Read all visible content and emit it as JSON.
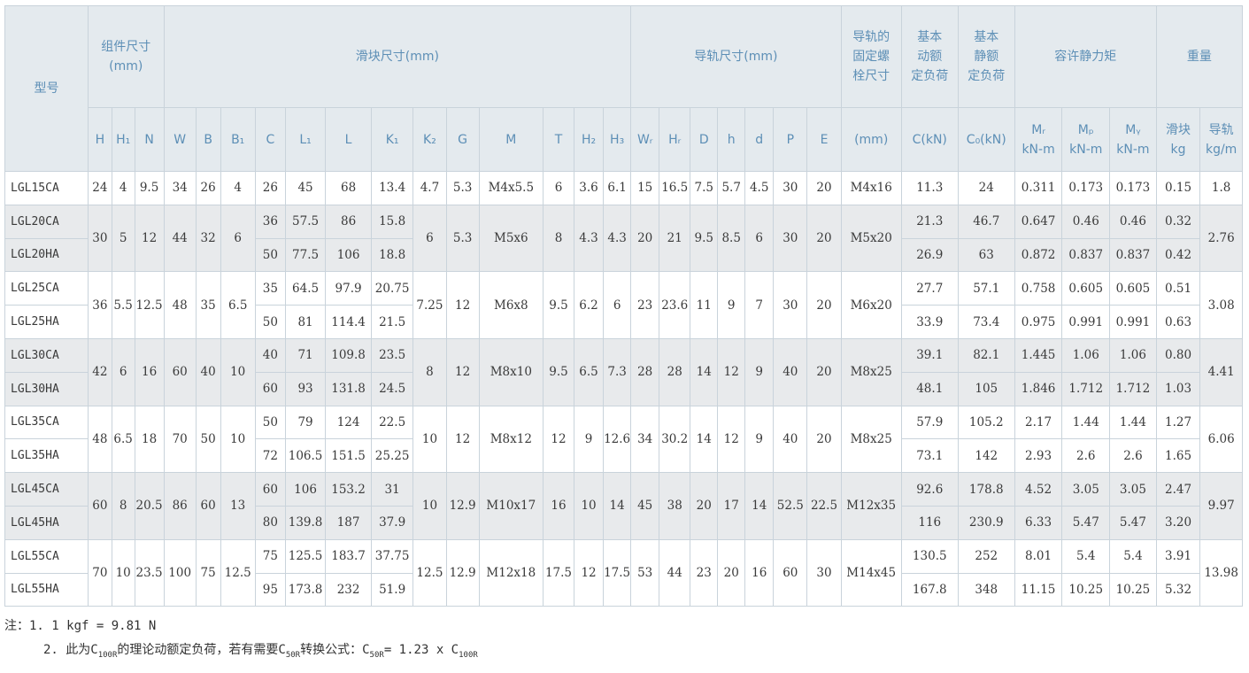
{
  "headers": {
    "model": "型号",
    "assembly_dim": "组件尺寸\n(mm)",
    "block_dim": "滑块尺寸(mm)",
    "rail_dim": "导轨尺寸(mm)",
    "rail_bolt": "导轨的\n固定螺\n栓尺寸",
    "basic_dynamic": "基本\n动额\n定负荷",
    "basic_static": "基本\n静额\n定负荷",
    "static_moment": "容许静力矩",
    "weight": "重量",
    "sub": [
      "H",
      "H₁",
      "N",
      "W",
      "B",
      "B₁",
      "C",
      "L₁",
      "L",
      "K₁",
      "K₂",
      "G",
      "M",
      "T",
      "H₂",
      "H₃",
      "Wᵣ",
      "Hᵣ",
      "D",
      "h",
      "d",
      "P",
      "E",
      "(mm)",
      "C(kN)",
      "C₀(kN)"
    ],
    "moment_cols": [
      "Mᵣ",
      "Mₚ",
      "Mᵧ"
    ],
    "moment_units": [
      "kN-m",
      "kN-m",
      "kN-m"
    ],
    "weight_cols": [
      "滑块",
      "导轨"
    ],
    "weight_units": [
      "kg",
      "kg/m"
    ]
  },
  "rows": [
    {
      "model": "LGL15CA",
      "H": "24",
      "H1": "4",
      "N": "9.5",
      "W": "34",
      "B": "26",
      "B1": "4",
      "C": "26",
      "L1": "45",
      "L": "68",
      "K1": "13.4",
      "K2": "4.7",
      "G": "5.3",
      "M": "M4x5.5",
      "T": "6",
      "H2": "3.6",
      "H3": "6.1",
      "WR": "15",
      "HR": "16.5",
      "D": "7.5",
      "h": "5.7",
      "d": "4.5",
      "P": "30",
      "E": "20",
      "bolt": "M4x16",
      "Ckn": "11.3",
      "C0kn": "24",
      "MR": "0.311",
      "MP": "0.173",
      "MY": "0.173",
      "wb": "0.15",
      "wr": "1.8"
    },
    {
      "model": "LGL20CA",
      "H": "30",
      "H1": "5",
      "N": "12",
      "W": "44",
      "B": "32",
      "B1": "6",
      "C": "36",
      "L1": "57.5",
      "L": "86",
      "K1": "15.8",
      "K2": "6",
      "G": "5.3",
      "M": "M5x6",
      "T": "8",
      "H2": "4.3",
      "H3": "4.3",
      "WR": "20",
      "HR": "21",
      "D": "9.5",
      "h": "8.5",
      "d": "6",
      "P": "30",
      "E": "20",
      "bolt": "M5x20",
      "Ckn": "21.3",
      "C0kn": "46.7",
      "MR": "0.647",
      "MP": "0.46",
      "MY": "0.46",
      "wb": "0.32",
      "wr": "2.76"
    },
    {
      "model": "LGL20HA",
      "C": "50",
      "L1": "77.5",
      "L": "106",
      "K1": "18.8",
      "Ckn": "26.9",
      "C0kn": "63",
      "MR": "0.872",
      "MP": "0.837",
      "MY": "0.837",
      "wb": "0.42"
    },
    {
      "model": "LGL25CA",
      "H": "36",
      "H1": "5.5",
      "N": "12.5",
      "W": "48",
      "B": "35",
      "B1": "6.5",
      "C": "35",
      "L1": "64.5",
      "L": "97.9",
      "K1": "20.75",
      "K2": "7.25",
      "G": "12",
      "M": "M6x8",
      "T": "9.5",
      "H2": "6.2",
      "H3": "6",
      "WR": "23",
      "HR": "23.6",
      "D": "11",
      "h": "9",
      "d": "7",
      "P": "30",
      "E": "20",
      "bolt": "M6x20",
      "Ckn": "27.7",
      "C0kn": "57.1",
      "MR": "0.758",
      "MP": "0.605",
      "MY": "0.605",
      "wb": "0.51",
      "wr": "3.08"
    },
    {
      "model": "LGL25HA",
      "C": "50",
      "L1": "81",
      "L": "114.4",
      "K1": "21.5",
      "Ckn": "33.9",
      "C0kn": "73.4",
      "MR": "0.975",
      "MP": "0.991",
      "MY": "0.991",
      "wb": "0.63"
    },
    {
      "model": "LGL30CA",
      "H": "42",
      "H1": "6",
      "N": "16",
      "W": "60",
      "B": "40",
      "B1": "10",
      "C": "40",
      "L1": "71",
      "L": "109.8",
      "K1": "23.5",
      "K2": "8",
      "G": "12",
      "M": "M8x10",
      "T": "9.5",
      "H2": "6.5",
      "H3": "7.3",
      "WR": "28",
      "HR": "28",
      "D": "14",
      "h": "12",
      "d": "9",
      "P": "40",
      "E": "20",
      "bolt": "M8x25",
      "Ckn": "39.1",
      "C0kn": "82.1",
      "MR": "1.445",
      "MP": "1.06",
      "MY": "1.06",
      "wb": "0.80",
      "wr": "4.41"
    },
    {
      "model": "LGL30HA",
      "C": "60",
      "L1": "93",
      "L": "131.8",
      "K1": "24.5",
      "Ckn": "48.1",
      "C0kn": "105",
      "MR": "1.846",
      "MP": "1.712",
      "MY": "1.712",
      "wb": "1.03"
    },
    {
      "model": "LGL35CA",
      "H": "48",
      "H1": "6.5",
      "N": "18",
      "W": "70",
      "B": "50",
      "B1": "10",
      "C": "50",
      "L1": "79",
      "L": "124",
      "K1": "22.5",
      "K2": "10",
      "G": "12",
      "M": "M8x12",
      "T": "12",
      "H2": "9",
      "H3": "12.6",
      "WR": "34",
      "HR": "30.2",
      "D": "14",
      "h": "12",
      "d": "9",
      "P": "40",
      "E": "20",
      "bolt": "M8x25",
      "Ckn": "57.9",
      "C0kn": "105.2",
      "MR": "2.17",
      "MP": "1.44",
      "MY": "1.44",
      "wb": "1.27",
      "wr": "6.06"
    },
    {
      "model": "LGL35HA",
      "C": "72",
      "L1": "106.5",
      "L": "151.5",
      "K1": "25.25",
      "Ckn": "73.1",
      "C0kn": "142",
      "MR": "2.93",
      "MP": "2.6",
      "MY": "2.6",
      "wb": "1.65"
    },
    {
      "model": "LGL45CA",
      "H": "60",
      "H1": "8",
      "N": "20.5",
      "W": "86",
      "B": "60",
      "B1": "13",
      "C": "60",
      "L1": "106",
      "L": "153.2",
      "K1": "31",
      "K2": "10",
      "G": "12.9",
      "M": "M10x17",
      "T": "16",
      "H2": "10",
      "H3": "14",
      "WR": "45",
      "HR": "38",
      "D": "20",
      "h": "17",
      "d": "14",
      "P": "52.5",
      "E": "22.5",
      "bolt": "M12x35",
      "Ckn": "92.6",
      "C0kn": "178.8",
      "MR": "4.52",
      "MP": "3.05",
      "MY": "3.05",
      "wb": "2.47",
      "wr": "9.97"
    },
    {
      "model": "LGL45HA",
      "C": "80",
      "L1": "139.8",
      "L": "187",
      "K1": "37.9",
      "Ckn": "116",
      "C0kn": "230.9",
      "MR": "6.33",
      "MP": "5.47",
      "MY": "5.47",
      "wb": "3.20"
    },
    {
      "model": "LGL55CA",
      "H": "70",
      "H1": "10",
      "N": "23.5",
      "W": "100",
      "B": "75",
      "B1": "12.5",
      "C": "75",
      "L1": "125.5",
      "L": "183.7",
      "K1": "37.75",
      "K2": "12.5",
      "G": "12.9",
      "M": "M12x18",
      "T": "17.5",
      "H2": "12",
      "H3": "17.5",
      "WR": "53",
      "HR": "44",
      "D": "23",
      "h": "20",
      "d": "16",
      "P": "60",
      "E": "30",
      "bolt": "M14x45",
      "Ckn": "130.5",
      "C0kn": "252",
      "MR": "8.01",
      "MP": "5.4",
      "MY": "5.4",
      "wb": "3.91",
      "wr": "13.98"
    },
    {
      "model": "LGL55HA",
      "C": "95",
      "L1": "173.8",
      "L": "232",
      "K1": "51.9",
      "Ckn": "167.8",
      "C0kn": "348",
      "MR": "11.15",
      "MP": "10.25",
      "MY": "10.25",
      "wb": "5.32"
    }
  ],
  "notes": {
    "line1": "注：1. 1 kgf = 9.81 N",
    "line2_a": "2. 此为C",
    "line2_sub1": "100R",
    "line2_b": "的理论动额定负荷，若有需要C",
    "line2_sub2": "50R",
    "line2_c": "转换公式：C",
    "line2_sub3": "50R",
    "line2_d": "= 1.23 x C",
    "line2_sub4": "100R"
  },
  "colors": {
    "header_bg": "#e4eaee",
    "header_text": "#5d8fb6",
    "shade_bg": "#e8eaec",
    "border": "#c9d3db"
  }
}
